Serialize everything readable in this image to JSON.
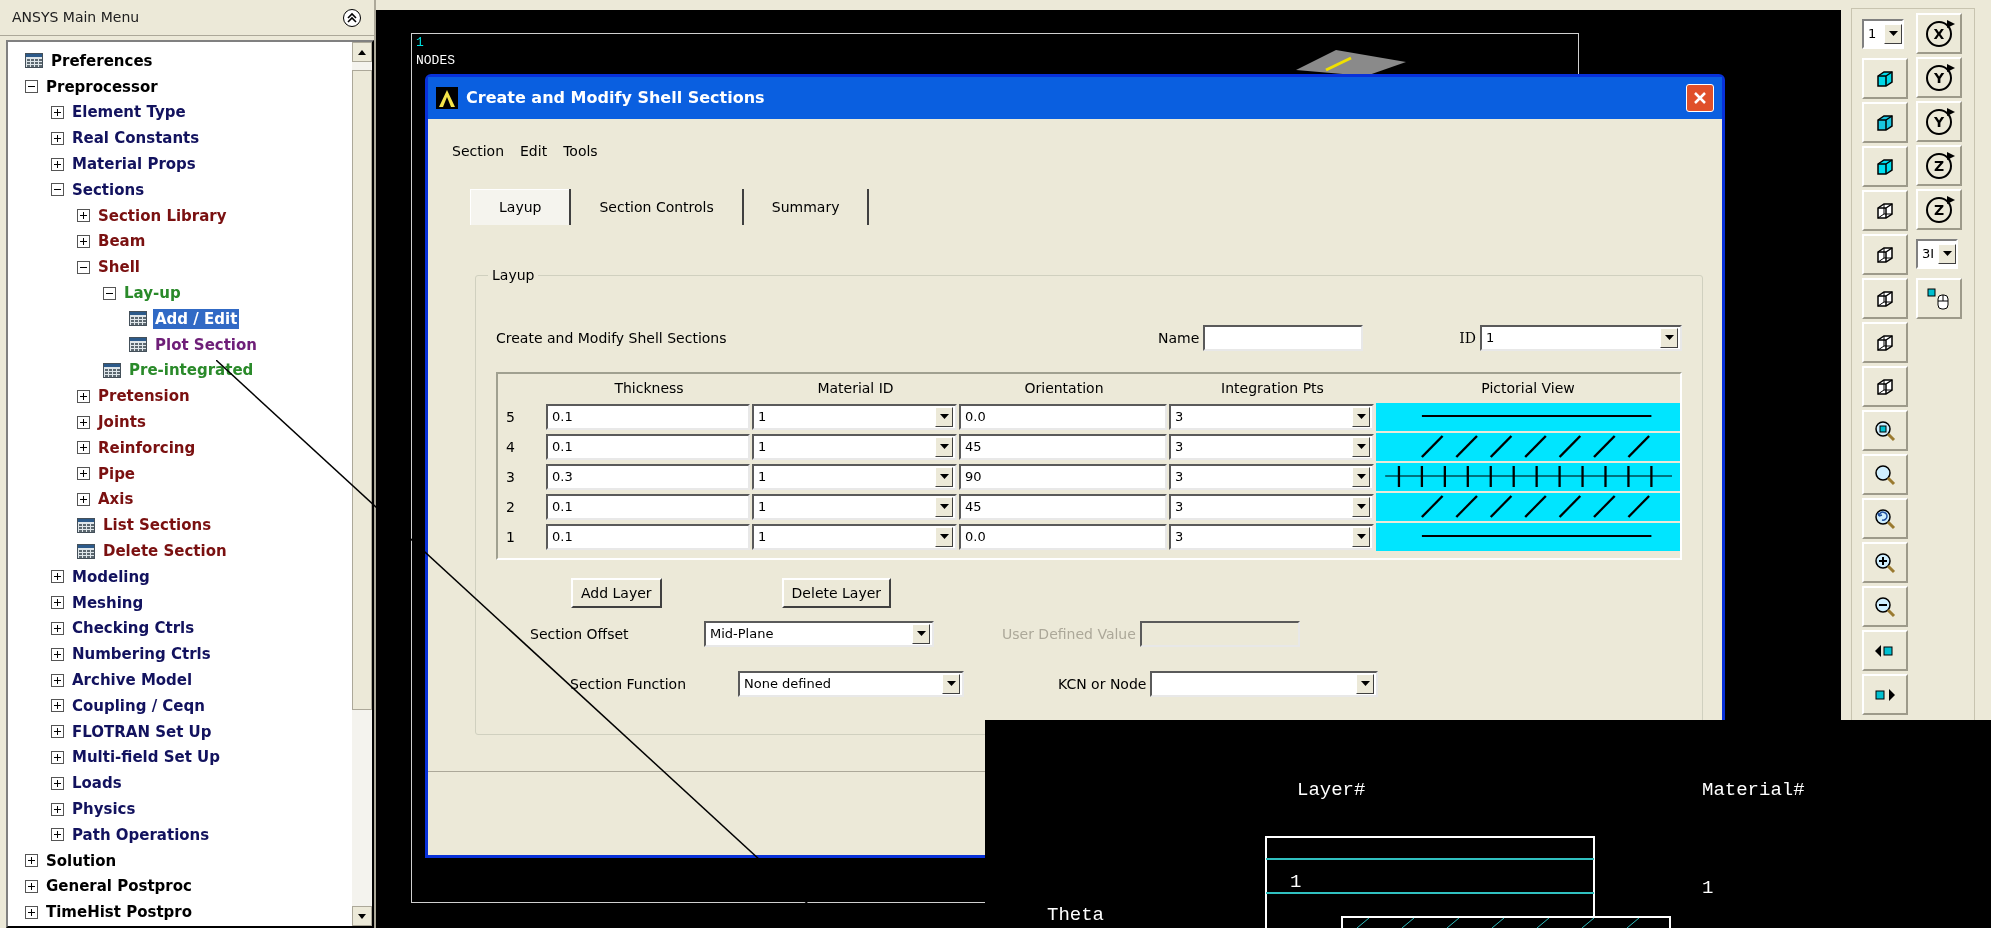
{
  "main_menu": {
    "title": "ANSYS Main Menu",
    "items": [
      {
        "label": "Preferences",
        "kind": "command",
        "selected": false,
        "color": "#000000"
      },
      {
        "label": "Preprocessor",
        "kind": "folder",
        "expanded": true,
        "selected": false,
        "color": "#000000",
        "children": [
          {
            "label": "Element Type",
            "kind": "folder",
            "expanded": false,
            "selected": false,
            "color": "#12125e"
          },
          {
            "label": "Real Constants",
            "kind": "folder",
            "expanded": false,
            "selected": false,
            "color": "#12125e"
          },
          {
            "label": "Material Props",
            "kind": "folder",
            "expanded": false,
            "selected": false,
            "color": "#12125e"
          },
          {
            "label": "Sections",
            "kind": "folder",
            "expanded": true,
            "selected": false,
            "color": "#12125e",
            "children": [
              {
                "label": "Section Library",
                "kind": "folder",
                "expanded": false,
                "selected": false,
                "color": "#7a1010"
              },
              {
                "label": "Beam",
                "kind": "folder",
                "expanded": false,
                "selected": false,
                "color": "#7a1010"
              },
              {
                "label": "Shell",
                "kind": "folder",
                "expanded": true,
                "selected": false,
                "color": "#7a1010",
                "children": [
                  {
                    "label": "Lay-up",
                    "kind": "folder",
                    "expanded": true,
                    "selected": false,
                    "color": "#2a8a2a",
                    "children": [
                      {
                        "label": "Add / Edit",
                        "kind": "command",
                        "selected": true
                      },
                      {
                        "label": "Plot Section",
                        "kind": "command",
                        "selected": false,
                        "color": "#6e1e78"
                      }
                    ]
                  },
                  {
                    "label": "Pre-integrated",
                    "kind": "command",
                    "selected": false,
                    "color": "#2a8a2a"
                  }
                ]
              },
              {
                "label": "Pretension",
                "kind": "folder",
                "expanded": false,
                "selected": false,
                "color": "#7a1010"
              },
              {
                "label": "Joints",
                "kind": "folder",
                "expanded": false,
                "selected": false,
                "color": "#7a1010"
              },
              {
                "label": "Reinforcing",
                "kind": "folder",
                "expanded": false,
                "selected": false,
                "color": "#7a1010"
              },
              {
                "label": "Pipe",
                "kind": "folder",
                "expanded": false,
                "selected": false,
                "color": "#7a1010"
              },
              {
                "label": "Axis",
                "kind": "folder",
                "expanded": false,
                "selected": false,
                "color": "#7a1010"
              },
              {
                "label": "List Sections",
                "kind": "command",
                "selected": false,
                "color": "#7a1010"
              },
              {
                "label": "Delete Section",
                "kind": "command",
                "selected": false,
                "color": "#7a1010"
              }
            ]
          },
          {
            "label": "Modeling",
            "kind": "folder",
            "expanded": false,
            "selected": false,
            "color": "#12125e"
          },
          {
            "label": "Meshing",
            "kind": "folder",
            "expanded": false,
            "selected": false,
            "color": "#12125e"
          },
          {
            "label": "Checking Ctrls",
            "kind": "folder",
            "expanded": false,
            "selected": false,
            "color": "#12125e"
          },
          {
            "label": "Numbering Ctrls",
            "kind": "folder",
            "expanded": false,
            "selected": false,
            "color": "#12125e"
          },
          {
            "label": "Archive Model",
            "kind": "folder",
            "expanded": false,
            "selected": false,
            "color": "#12125e"
          },
          {
            "label": "Coupling / Ceqn",
            "kind": "folder",
            "expanded": false,
            "selected": false,
            "color": "#12125e"
          },
          {
            "label": "FLOTRAN Set Up",
            "kind": "folder",
            "expanded": false,
            "selected": false,
            "color": "#12125e"
          },
          {
            "label": "Multi-field Set Up",
            "kind": "folder",
            "expanded": false,
            "selected": false,
            "color": "#12125e"
          },
          {
            "label": "Loads",
            "kind": "folder",
            "expanded": false,
            "selected": false,
            "color": "#12125e"
          },
          {
            "label": "Physics",
            "kind": "folder",
            "expanded": false,
            "selected": false,
            "color": "#12125e"
          },
          {
            "label": "Path Operations",
            "kind": "folder",
            "expanded": false,
            "selected": false,
            "color": "#12125e"
          }
        ]
      },
      {
        "label": "Solution",
        "kind": "folder",
        "expanded": false,
        "selected": false,
        "color": "#000000"
      },
      {
        "label": "General Postproc",
        "kind": "folder",
        "expanded": false,
        "selected": false,
        "color": "#000000"
      },
      {
        "label": "TimeHist Postpro",
        "kind": "folder",
        "expanded": false,
        "selected": false,
        "color": "#000000"
      }
    ]
  },
  "graphics": {
    "window_number": "1",
    "label": "NODES"
  },
  "dialog": {
    "title": "Create and Modify Shell Sections",
    "menu": [
      "Section",
      "Edit",
      "Tools"
    ],
    "tabs": [
      {
        "label": "Layup",
        "selected": true
      },
      {
        "label": "Section Controls",
        "selected": false
      },
      {
        "label": "Summary",
        "selected": false
      }
    ],
    "group_label": "Layup",
    "description": "Create and Modify Shell Sections",
    "name_field": {
      "label": "Name"
    },
    "id_field": {
      "label": "ID",
      "value": "1"
    },
    "table": {
      "columns": [
        "Thickness",
        "Material ID",
        "Orientation",
        "Integration Pts",
        "Pictorial View"
      ],
      "rows": [
        {
          "number": "5",
          "thickness": "0.1",
          "material_id": "1",
          "orientation": "0.0",
          "integration_pts": "3",
          "kind": "horizontal"
        },
        {
          "number": "4",
          "thickness": "0.1",
          "material_id": "1",
          "orientation": "45",
          "integration_pts": "3",
          "kind": "diagonal"
        },
        {
          "number": "3",
          "thickness": "0.3",
          "material_id": "1",
          "orientation": "90",
          "integration_pts": "3",
          "kind": "vertical"
        },
        {
          "number": "2",
          "thickness": "0.1",
          "material_id": "1",
          "orientation": "45",
          "integration_pts": "3",
          "kind": "diagonal"
        },
        {
          "number": "1",
          "thickness": "0.1",
          "material_id": "1",
          "orientation": "0.0",
          "integration_pts": "3",
          "kind": "horizontal"
        }
      ]
    },
    "buttons": [
      "Add Layer",
      "Delete Layer"
    ],
    "section_offset": {
      "label": "Section Offset",
      "value": "Mid-Plane"
    },
    "user_defined_value": {
      "label": "User Defined Value",
      "disabled": true
    },
    "section_function": {
      "label": "Section Function",
      "value": "None defined"
    },
    "kcn_or_node": {
      "label": "KCN or Node"
    }
  },
  "plot": {
    "layer_header": "Layer#",
    "material_header": "Material#",
    "layer_label": "1",
    "material_label": "1",
    "theta_label": "Theta"
  },
  "toolbar": {
    "left": [
      {
        "kind": "dropdown",
        "value": "1"
      },
      {
        "kind": "iso-cube"
      },
      {
        "kind": "oblique-cube"
      },
      {
        "kind": "front-cube"
      },
      {
        "kind": "wire-cube"
      },
      {
        "kind": "wire-cube"
      },
      {
        "kind": "wire-cube"
      },
      {
        "kind": "wire-cube"
      },
      {
        "kind": "wire-cube"
      },
      {
        "kind": "zoom-box"
      },
      {
        "kind": "zoom"
      },
      {
        "kind": "zoom-back"
      },
      {
        "kind": "zoom-in"
      },
      {
        "kind": "zoom-out"
      },
      {
        "kind": "pan-left"
      },
      {
        "kind": "pan-right"
      }
    ],
    "right": [
      {
        "kind": "rotate",
        "axis": "X"
      },
      {
        "kind": "rotate",
        "axis": "Y"
      },
      {
        "kind": "rotate",
        "axis": "Y"
      },
      {
        "kind": "rotate",
        "axis": "Z"
      },
      {
        "kind": "rotate",
        "axis": "Z"
      },
      {
        "kind": "dropdown",
        "value": "3I"
      },
      {
        "kind": "mouse-cube"
      }
    ]
  }
}
